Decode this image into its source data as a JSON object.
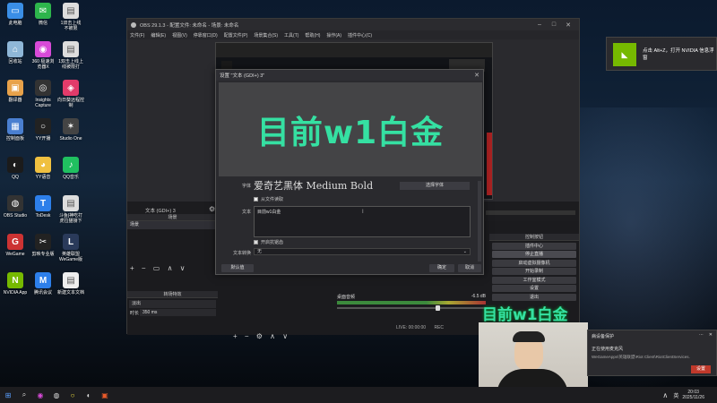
{
  "desktop": {
    "icons": [
      {
        "label": "此电脑",
        "color": "#3a8ee6",
        "glyph": "▭"
      },
      {
        "label": "微信",
        "color": "#2db54c",
        "glyph": "✉"
      },
      {
        "label": "1双击上线\n不被限",
        "color": "#dddddd",
        "glyph": "▤"
      },
      {
        "label": "回收站",
        "color": "#8fb7d8",
        "glyph": "⌂"
      },
      {
        "label": "360 极速浏\n览器X",
        "color": "#d84ad8",
        "glyph": "◉"
      },
      {
        "label": "1双击上线上\n线被限打",
        "color": "#dddddd",
        "glyph": "▤"
      },
      {
        "label": "翻译器",
        "color": "#e8a24a",
        "glyph": "▣"
      },
      {
        "label": "Insights\nCapture",
        "color": "#333333",
        "glyph": "◎"
      },
      {
        "label": "向日葵远程控\n制",
        "color": "#e23b6a",
        "glyph": "◈"
      },
      {
        "label": "控制面板",
        "color": "#4a7fd0",
        "glyph": "▦"
      },
      {
        "label": "YY开播",
        "color": "#222222",
        "glyph": "○"
      },
      {
        "label": "Studio One",
        "color": "#444444",
        "glyph": "✶"
      },
      {
        "label": "QQ",
        "color": "#1b1b1b",
        "glyph": "◐"
      },
      {
        "label": "YY语音",
        "color": "#f0c040",
        "glyph": "◕"
      },
      {
        "label": "QQ音乐",
        "color": "#20c060",
        "glyph": "♪"
      },
      {
        "label": "OBS Studio",
        "color": "#333333",
        "glyph": "◍"
      },
      {
        "label": "ToDesk",
        "color": "#2d7fea",
        "glyph": "T"
      },
      {
        "label": "斗鱼|神吃打\n虎拉猫接下",
        "color": "#dddddd",
        "glyph": "▤"
      },
      {
        "label": "WeGame",
        "color": "#cc3333",
        "glyph": "G"
      },
      {
        "label": "剪映专业版",
        "color": "#222222",
        "glyph": "✂"
      },
      {
        "label": "英雄联盟\nWeGame版",
        "color": "#2a3a5a",
        "glyph": "L"
      },
      {
        "label": "NVIDIA App",
        "color": "#76b900",
        "glyph": "N"
      },
      {
        "label": "腾讯会议",
        "color": "#2d7fea",
        "glyph": "M"
      },
      {
        "label": "新建文本文档",
        "color": "#eeeeee",
        "glyph": "▤"
      }
    ]
  },
  "obs": {
    "title": "OBS 29.1.3 - 配置文件: 未命名 - 场景: 未命名",
    "menu": [
      "文件(F)",
      "编辑(E)",
      "视图(V)",
      "停靠窗口(D)",
      "配置文件(P)",
      "场景集合(S)",
      "工具(T)",
      "帮助(H)",
      "操作(A)",
      "插件中心(C)"
    ],
    "source_bar_label": "文本 (GDI+) 3",
    "scenes_header": "场景",
    "scene_item": "场景",
    "transitions_header": "转场特效",
    "transition_name": "淡出",
    "duration_label": "时长",
    "duration_value": "350 ms",
    "audio_label": "桌面音频",
    "audio_db": "-6.5 dB",
    "controls_header": "控制按钮",
    "controls": [
      "插件中心",
      "停止直播",
      "启动虚拟摄像机",
      "开始录制",
      "工作室模式",
      "设置",
      "退出"
    ],
    "status": "LIVE: 00:00:00",
    "status_rec": "REC"
  },
  "dialog": {
    "title": "设置 \"文本 (GDI+) 3\"",
    "preview_text": "目前w1白金",
    "font_label": "字体",
    "font_name": "爱奇艺黑体 Medium Bold",
    "select_font_button": "选择字体",
    "read_from_file": "从文件读取",
    "text_label": "文本",
    "text_value": "目前w1白金",
    "antialias": "开启抗锯齿",
    "transform_label": "文本转换",
    "transform_value": "无",
    "defaults_button": "默认值",
    "ok_button": "确定",
    "cancel_button": "取消"
  },
  "overlay_text": "目前w1白金",
  "notification": {
    "text": "点击 Alt+Z，打开 NVIDIA 信息浮窗"
  },
  "security_toast": {
    "title": "病设备保护",
    "line1": "WeGameApps\\英雄联盟\\Riot Client\\RiotClientServices...",
    "line2": "正在使用麦克风",
    "button": "设置"
  },
  "taskbar": {
    "time": "20:03",
    "date": "2025/11/26",
    "lang": "英"
  }
}
